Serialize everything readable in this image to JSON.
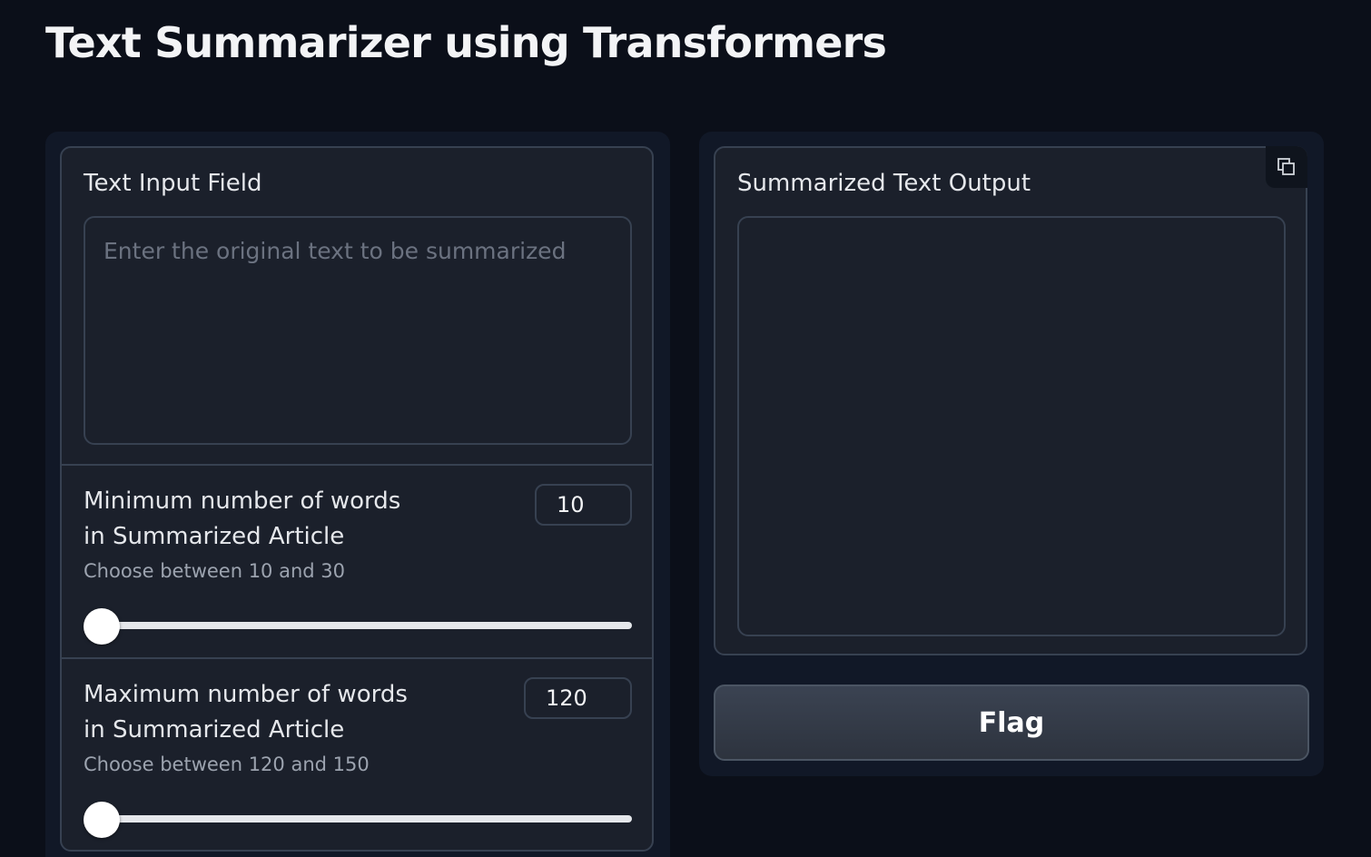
{
  "app": {
    "title": "Text Summarizer using Transformers"
  },
  "input_panel": {
    "text_field": {
      "label": "Text Input Field",
      "placeholder": "Enter the original text to be summarized",
      "value": ""
    },
    "min_words": {
      "label": "Minimum number of words in Summarized Article",
      "info": "Choose between 10 and 30",
      "value": "10",
      "range_min": 10,
      "range_max": 30
    },
    "max_words": {
      "label": "Maximum number of words in Summarized Article",
      "info": "Choose between 120 and 150",
      "value": "120",
      "range_min": 120,
      "range_max": 150
    }
  },
  "output_panel": {
    "label": "Summarized Text Output",
    "value": "",
    "copy_icon": "copy-icon"
  },
  "actions": {
    "flag_label": "Flag"
  },
  "colors": {
    "background": "#0b0f19",
    "panel": "#111827",
    "block": "#1b202b",
    "border": "#374151",
    "slider_track": "#e5e7eb",
    "flag_button": "#374151"
  }
}
